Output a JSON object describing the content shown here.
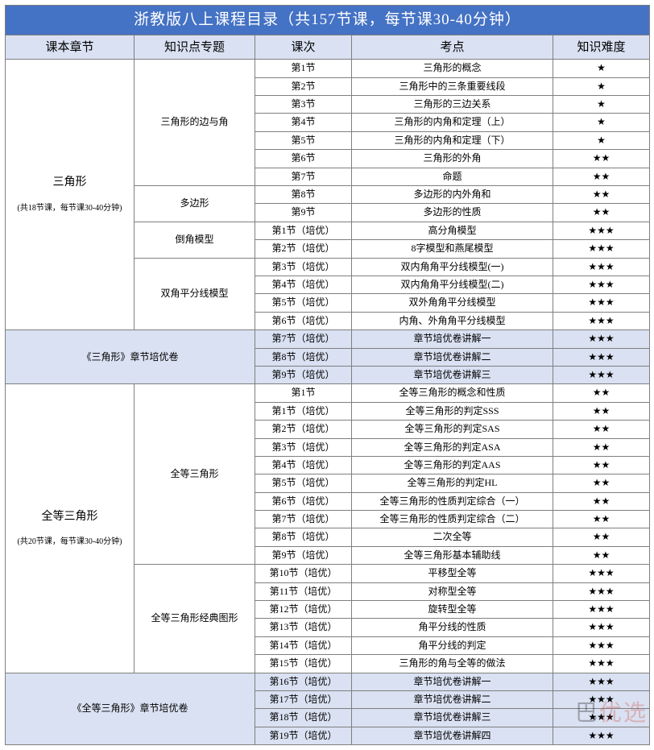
{
  "title": "浙教版八上课程目录（共157节课，每节课30-40分钟）",
  "headers": {
    "c1": "课本章节",
    "c2": "知识点专题",
    "c3": "课次",
    "c4": "考点",
    "c5": "知识难度"
  },
  "stars": {
    "s1": "★",
    "s2": "★★",
    "s3": "★★★"
  },
  "watermark": {
    "a": "巴",
    "b": "优",
    "c": "选"
  },
  "chapters": [
    {
      "name": "三角形",
      "sub": "(共18节课，每节课30-40分钟)",
      "review": "《三角形》章节培优卷",
      "groups": [
        {
          "topic": "三角形的边与角",
          "rows": [
            {
              "lesson": "第1节",
              "point": "三角形的概念",
              "diff": "s1"
            },
            {
              "lesson": "第2节",
              "point": "三角形中的三条重要线段",
              "diff": "s1"
            },
            {
              "lesson": "第3节",
              "point": "三角形的三边关系",
              "diff": "s1"
            },
            {
              "lesson": "第4节",
              "point": "三角形的内角和定理（上）",
              "diff": "s1"
            },
            {
              "lesson": "第5节",
              "point": "三角形的内角和定理（下）",
              "diff": "s1"
            },
            {
              "lesson": "第6节",
              "point": "三角形的外角",
              "diff": "s2"
            },
            {
              "lesson": "第7节",
              "point": "命题",
              "diff": "s2"
            }
          ]
        },
        {
          "topic": "多边形",
          "rows": [
            {
              "lesson": "第8节",
              "point": "多边形的内外角和",
              "diff": "s2"
            },
            {
              "lesson": "第9节",
              "point": "多边形的性质",
              "diff": "s2"
            }
          ]
        },
        {
          "topic": "倒角模型",
          "rows": [
            {
              "lesson": "第1节（培优）",
              "point": "高分角模型",
              "diff": "s3"
            },
            {
              "lesson": "第2节（培优）",
              "point": "8字模型和燕尾模型",
              "diff": "s3"
            }
          ]
        },
        {
          "topic": "双角平分线模型",
          "rows": [
            {
              "lesson": "第3节（培优）",
              "point": "双内角角平分线模型(一)",
              "diff": "s3"
            },
            {
              "lesson": "第4节（培优）",
              "point": "双内角角平分线模型(二)",
              "diff": "s3"
            },
            {
              "lesson": "第5节（培优）",
              "point": "双外角角平分线模型",
              "diff": "s3"
            },
            {
              "lesson": "第6节（培优）",
              "point": "内角、外角角平分线模型",
              "diff": "s3"
            }
          ]
        }
      ],
      "review_rows": [
        {
          "lesson": "第7节（培优）",
          "point": "章节培优卷讲解一",
          "diff": "s3"
        },
        {
          "lesson": "第8节（培优）",
          "point": "章节培优卷讲解二",
          "diff": "s3"
        },
        {
          "lesson": "第9节（培优）",
          "point": "章节培优卷讲解三",
          "diff": "s3"
        }
      ]
    },
    {
      "name": "全等三角形",
      "sub": "(共20节课，每节课30-40分钟)",
      "review": "《全等三角形》章节培优卷",
      "groups": [
        {
          "topic": "全等三角形",
          "rows": [
            {
              "lesson": "第1节",
              "point": "全等三角形的概念和性质",
              "diff": "s2"
            },
            {
              "lesson": "第1节（培优）",
              "point": "全等三角形的判定SSS",
              "diff": "s2"
            },
            {
              "lesson": "第2节（培优）",
              "point": "全等三角形的判定SAS",
              "diff": "s2"
            },
            {
              "lesson": "第3节（培优）",
              "point": "全等三角形的判定ASA",
              "diff": "s2"
            },
            {
              "lesson": "第4节（培优）",
              "point": "全等三角形的判定AAS",
              "diff": "s2"
            },
            {
              "lesson": "第5节（培优）",
              "point": "全等三角形的判定HL",
              "diff": "s2"
            },
            {
              "lesson": "第6节（培优）",
              "point": "全等三角形的性质判定综合（一）",
              "diff": "s2"
            },
            {
              "lesson": "第7节（培优）",
              "point": "全等三角形的性质判定综合（二）",
              "diff": "s2"
            },
            {
              "lesson": "第8节（培优）",
              "point": "二次全等",
              "diff": "s2"
            },
            {
              "lesson": "第9节（培优）",
              "point": "全等三角形基本辅助线",
              "diff": "s2"
            }
          ]
        },
        {
          "topic": "全等三角形经典图形",
          "rows": [
            {
              "lesson": "第10节（培优）",
              "point": "平移型全等",
              "diff": "s3"
            },
            {
              "lesson": "第11节（培优）",
              "point": "对称型全等",
              "diff": "s3"
            },
            {
              "lesson": "第12节（培优）",
              "point": "旋转型全等",
              "diff": "s3"
            },
            {
              "lesson": "第13节（培优）",
              "point": "角平分线的性质",
              "diff": "s3"
            },
            {
              "lesson": "第14节（培优）",
              "point": "角平分线的判定",
              "diff": "s3"
            },
            {
              "lesson": "第15节（培优）",
              "point": "三角形的角与全等的做法",
              "diff": "s3"
            }
          ]
        }
      ],
      "review_rows": [
        {
          "lesson": "第16节（培优）",
          "point": "章节培优卷讲解一",
          "diff": "s3"
        },
        {
          "lesson": "第17节（培优）",
          "point": "章节培优卷讲解二",
          "diff": "s3"
        },
        {
          "lesson": "第18节（培优）",
          "point": "章节培优卷讲解三",
          "diff": "s3"
        },
        {
          "lesson": "第19节（培优）",
          "point": "章节培优卷讲解四",
          "diff": "s3"
        }
      ]
    }
  ]
}
